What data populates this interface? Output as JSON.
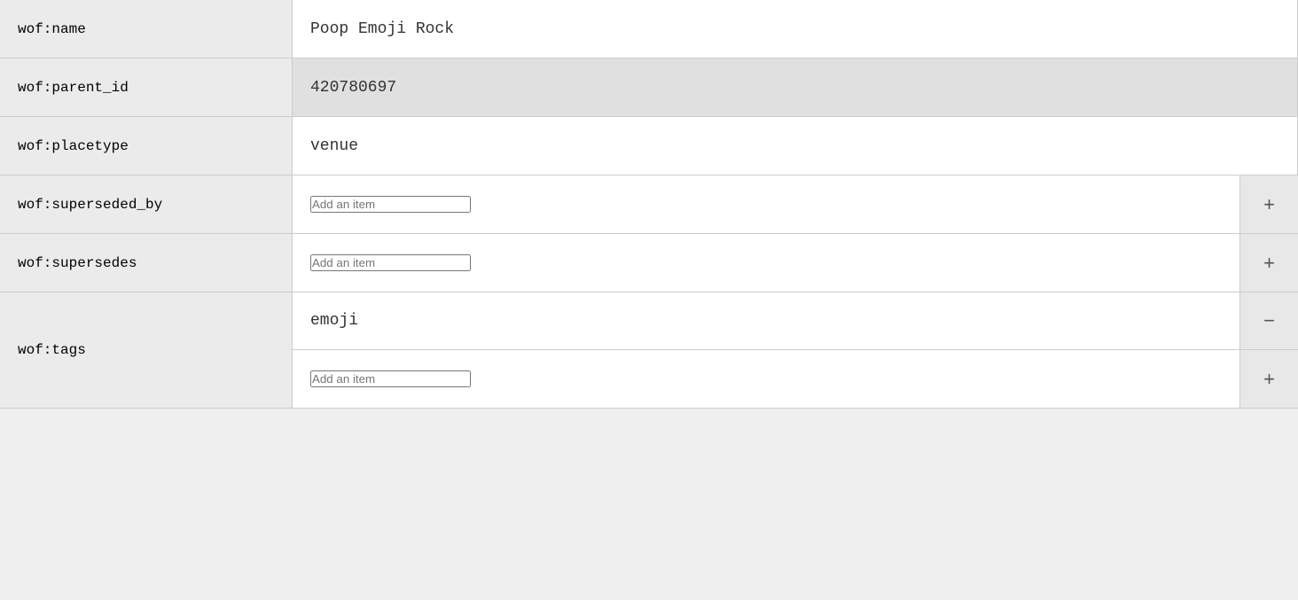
{
  "rows": [
    {
      "id": "name",
      "label": "wof:name",
      "type": "single",
      "value": "Poop Emoji Rock",
      "placeholder": "",
      "highlighted": false,
      "has_button": false
    },
    {
      "id": "parent_id",
      "label": "wof:parent_id",
      "type": "single",
      "value": "420780697",
      "placeholder": "",
      "highlighted": true,
      "has_button": false
    },
    {
      "id": "placetype",
      "label": "wof:placetype",
      "type": "single",
      "value": "venue",
      "placeholder": "",
      "highlighted": false,
      "has_button": false
    },
    {
      "id": "superseded_by",
      "label": "wof:superseded_by",
      "type": "single",
      "value": "",
      "placeholder": "Add an item",
      "highlighted": false,
      "has_button": true,
      "button_type": "plus"
    },
    {
      "id": "supersedes",
      "label": "wof:supersedes",
      "type": "single",
      "value": "",
      "placeholder": "Add an item",
      "highlighted": false,
      "has_button": true,
      "button_type": "plus"
    },
    {
      "id": "tags",
      "label": "wof:tags",
      "type": "multi",
      "items": [
        {
          "value": "emoji",
          "placeholder": "",
          "button_type": "minus"
        },
        {
          "value": "",
          "placeholder": "Add an item",
          "button_type": "plus"
        }
      ]
    }
  ],
  "buttons": {
    "plus": "+",
    "minus": "−"
  }
}
